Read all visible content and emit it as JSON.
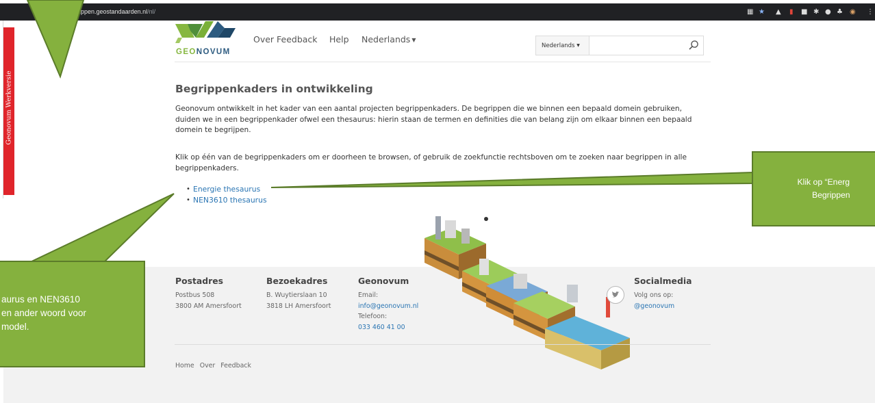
{
  "browser": {
    "url_host": "begrippen.geostandaarden.nl",
    "url_path": "/nl/",
    "lock_icon": "lock-icon",
    "extension_icons": [
      "translate-icon",
      "star-icon",
      "extension-icon",
      "extension-icon",
      "extension-icon",
      "extension-icon",
      "extension-icon",
      "extension-icon",
      "avatar-icon",
      "menu-icon"
    ]
  },
  "sidebar": {
    "label": "Geonovum Werkversie"
  },
  "header": {
    "logo_text_geo": "GEO",
    "logo_text_novum": "NOVUM",
    "nav": [
      {
        "label": "Over"
      },
      {
        "label": "Feedback"
      },
      {
        "label": "Help"
      },
      {
        "label": "Nederlands"
      }
    ],
    "search": {
      "lang_label": "Nederlands",
      "query": "",
      "placeholder": ""
    }
  },
  "main": {
    "title": "Begrippenkaders in ontwikkeling",
    "para1_line1": "Geonovum ontwikkelt in het kader van een aantal projecten begrippenkaders. De begrippen die we binnen een bepaald domein gebruiken,",
    "para1_line2": "duiden we in een begrippenkader ofwel een thesaurus: hierin staan de termen en definities die van belang zijn om elkaar binnen een bepaald",
    "para1_line3": "domein te begrijpen.",
    "para2_line1": "Klik op één van de begrippenkaders om er doorheen te browsen, of gebruik de zoekfunctie rechtsboven om te zoeken naar begrippen in alle",
    "para2_line2": "begrippenkaders.",
    "links": [
      {
        "label": "Energie thesaurus"
      },
      {
        "label": "NEN3610 thesaurus"
      }
    ]
  },
  "footer": {
    "postadres": {
      "heading": "Postadres",
      "lines": [
        "Postbus 508",
        "3800 AM Amersfoort"
      ]
    },
    "bezoekadres": {
      "heading": "Bezoekadres",
      "lines": [
        "B. Wuytierslaan 10",
        "3818 LH Amersfoort"
      ]
    },
    "geonovum": {
      "heading": "Geonovum",
      "email_label": "Email:",
      "email": "info@geonovum.nl",
      "phone_label": "Telefoon:",
      "phone": "033 460 41 00"
    },
    "social": {
      "heading": "Socialmedia",
      "follow": "Volg ons op:",
      "handle": "@geonovum"
    },
    "bottom_nav": [
      "Home",
      "Over",
      "Feedback"
    ]
  },
  "callouts": {
    "right_line1": "Klik op “Energ",
    "right_line2": "Begrippen",
    "left_line1": "aurus en NEN3610",
    "left_line2": "en ander woord voor",
    "left_line3": "model."
  },
  "colors": {
    "callout_green": "#85b13e",
    "sidebar_red": "#e0252b",
    "link_blue": "#2a75b3",
    "logo_green": "#86b740",
    "logo_blue": "#2d5b80"
  }
}
